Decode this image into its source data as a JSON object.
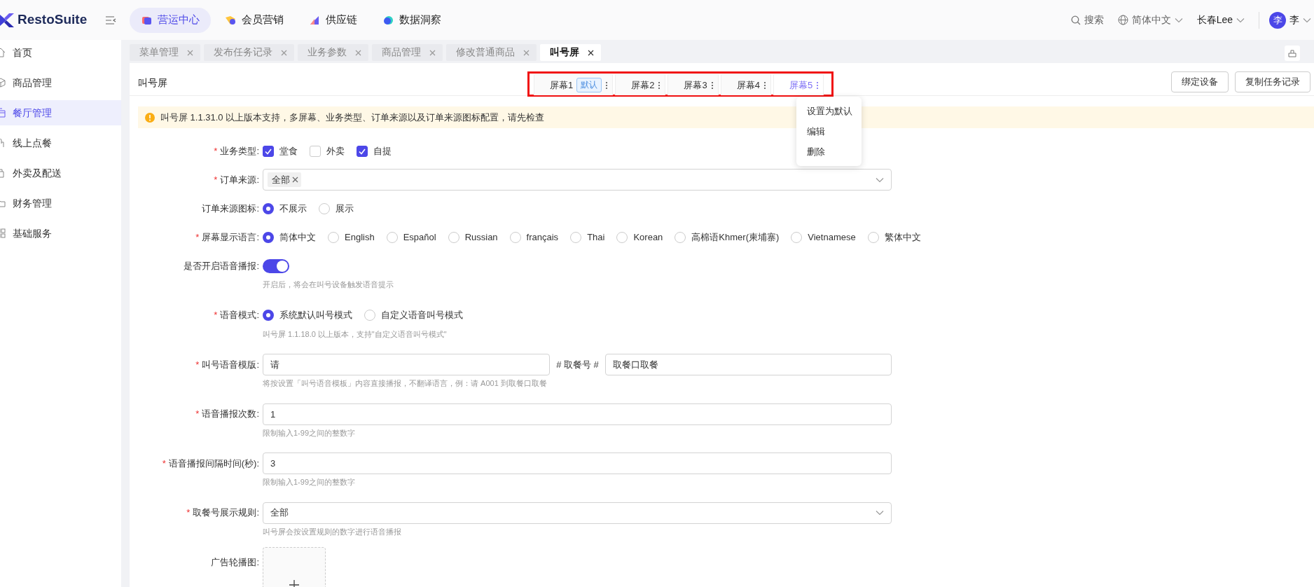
{
  "logo": "RestoSuite",
  "top_nav": [
    {
      "label": "营运中心",
      "selected": true
    },
    {
      "label": "会员营销",
      "selected": false
    },
    {
      "label": "供应链",
      "selected": false
    },
    {
      "label": "数据洞察",
      "selected": false
    }
  ],
  "header_tools": {
    "search": "搜索",
    "language": "简体中文",
    "store": "长春Lee",
    "avatar": "李",
    "user": "李"
  },
  "sidebar": {
    "items": [
      {
        "label": "首页",
        "selected": false
      },
      {
        "label": "商品管理",
        "selected": false
      },
      {
        "label": "餐厅管理",
        "selected": true
      },
      {
        "label": "线上点餐",
        "selected": false
      },
      {
        "label": "外卖及配送",
        "selected": false
      },
      {
        "label": "财务管理",
        "selected": false
      },
      {
        "label": "基础服务",
        "selected": false
      }
    ]
  },
  "page_tabs": [
    {
      "label": "菜单管理",
      "selected": false
    },
    {
      "label": "发布任务记录",
      "selected": false
    },
    {
      "label": "业务参数",
      "selected": false
    },
    {
      "label": "商品管理",
      "selected": false
    },
    {
      "label": "修改普通商品",
      "selected": false
    },
    {
      "label": "叫号屏",
      "selected": true
    }
  ],
  "page_title": "叫号屏",
  "screen_tabs": [
    {
      "label": "屏幕1",
      "badge": "默认",
      "selected": false
    },
    {
      "label": "屏幕2",
      "selected": false
    },
    {
      "label": "屏幕3",
      "selected": false
    },
    {
      "label": "屏幕4",
      "selected": false
    },
    {
      "label": "屏幕5",
      "selected": true
    }
  ],
  "screen_menu": [
    "设置为默认",
    "编辑",
    "删除"
  ],
  "buttons": [
    "绑定设备",
    "复制任务记录"
  ],
  "alert": "叫号屏 1.1.31.0 以上版本支持，多屏幕、业务类型、订单来源以及订单来源图标配置，请先检查",
  "form": [
    {
      "kind": "checkboxes",
      "label": "业务类型:",
      "required_mark": "*",
      "options": [
        {
          "label": "堂食",
          "checked": true
        },
        {
          "label": "外卖",
          "checked": false
        },
        {
          "label": "自提",
          "checked": true
        }
      ]
    },
    {
      "kind": "tags",
      "label": "订单来源:",
      "required_mark": "*",
      "tags": [
        "全部"
      ]
    },
    {
      "kind": "radios",
      "label": "订单来源图标:",
      "options": [
        {
          "label": "不展示",
          "selected": true
        },
        {
          "label": "展示",
          "selected": false
        }
      ]
    },
    {
      "kind": "radios",
      "label": "屏幕显示语言:",
      "required_mark": "*",
      "options": [
        {
          "label": "简体中文",
          "selected": true
        },
        {
          "label": "English",
          "selected": false
        },
        {
          "label": "Español",
          "selected": false
        },
        {
          "label": "Russian",
          "selected": false
        },
        {
          "label": "français",
          "selected": false
        },
        {
          "label": "Thai",
          "selected": false
        },
        {
          "label": "Korean",
          "selected": false
        },
        {
          "label": "高棉语Khmer(柬埔寨)",
          "selected": false
        },
        {
          "label": "Vietnamese",
          "selected": false
        },
        {
          "label": "繁体中文",
          "selected": false
        }
      ]
    },
    {
      "kind": "switch",
      "label": "是否开启语音播报:",
      "on": true,
      "hint": "开启后，将会在叫号设备触发语音提示"
    },
    {
      "kind": "radios",
      "label": "语音模式:",
      "required_mark": "*",
      "options": [
        {
          "label": "系统默认叫号模式",
          "selected": true
        },
        {
          "label": "自定义语音叫号模式",
          "selected": false
        }
      ],
      "hint": "叫号屏 1.1.18.0 以上版本，支持\"自定义语音叫号模式\""
    },
    {
      "kind": "template",
      "label": "叫号语音模版:",
      "required_mark": "*",
      "value": "请",
      "middle": "# 取餐号 #",
      "value2": "取餐口取餐",
      "hint": "将按设置「叫号语音模板」内容直接播报，不翻译语言，例：请 A001 到取餐口取餐"
    },
    {
      "kind": "input",
      "label": "语音播报次数:",
      "required_mark": "*",
      "value": "1",
      "hint": "限制输入1-99之间的整数字"
    },
    {
      "kind": "input",
      "label": "语音播报间隔时间(秒):",
      "required_mark": "*",
      "value": "3",
      "hint": "限制输入1-99之间的整数字"
    },
    {
      "kind": "select",
      "label": "取餐号展示规则:",
      "required_mark": "*",
      "value": "全部",
      "hint": "叫号屏会按设置规则的数字进行语音播报"
    },
    {
      "kind": "upload",
      "label": "广告轮播图:"
    }
  ]
}
